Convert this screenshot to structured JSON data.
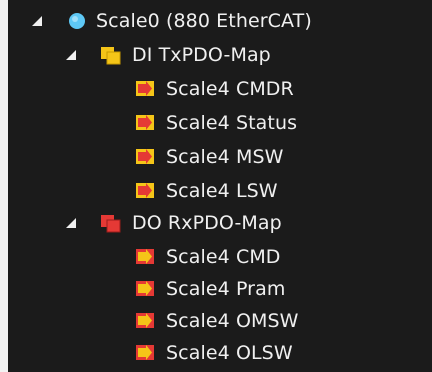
{
  "tree": {
    "root": {
      "label": "Scale0 (880 EtherCAT)",
      "expanded": true,
      "icon": "ethercat-device-icon",
      "children": [
        {
          "label": "DI TxPDO-Map",
          "expanded": true,
          "icon": "input-pdo-map-icon",
          "items": [
            {
              "label": "Scale4 CMDR",
              "icon": "input-variable-icon"
            },
            {
              "label": "Scale4 Status",
              "icon": "input-variable-icon"
            },
            {
              "label": "Scale4 MSW",
              "icon": "input-variable-icon"
            },
            {
              "label": "Scale4 LSW",
              "icon": "input-variable-icon"
            }
          ]
        },
        {
          "label": "DO RxPDO-Map",
          "expanded": true,
          "icon": "output-pdo-map-icon",
          "items": [
            {
              "label": "Scale4 CMD",
              "icon": "output-variable-icon"
            },
            {
              "label": "Scale4 Pram",
              "icon": "output-variable-icon"
            },
            {
              "label": "Scale4 OMSW",
              "icon": "output-variable-icon"
            },
            {
              "label": "Scale4 OLSW",
              "icon": "output-variable-icon"
            }
          ]
        }
      ]
    }
  },
  "colors": {
    "background": "#1b1b1b",
    "text": "#f0f0f0",
    "device_icon": "#4fc3f7",
    "input_icon": "#f5c518",
    "output_icon": "#e53935"
  }
}
